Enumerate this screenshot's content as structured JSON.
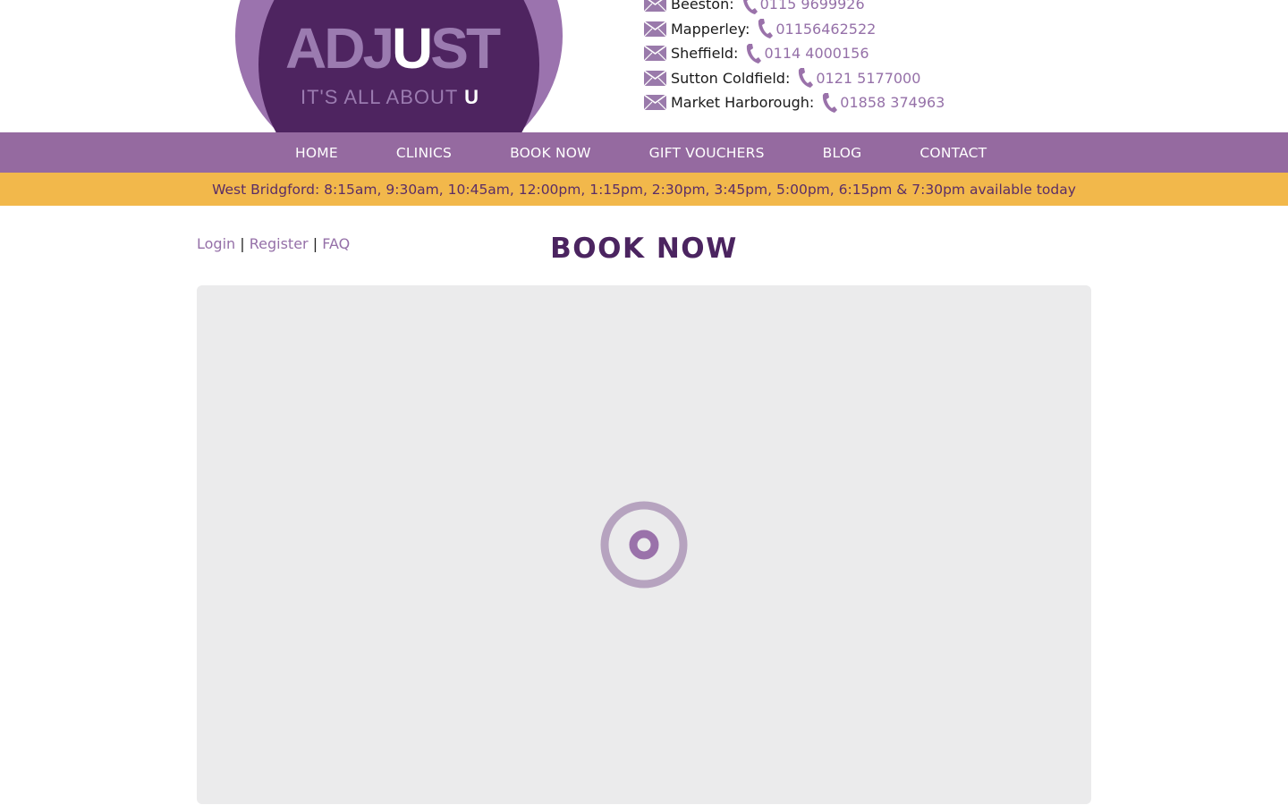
{
  "logo": {
    "adj": "ADJ",
    "u": "U",
    "st": "ST",
    "tagline": "IT'S ALL ABOUT",
    "tagline_u": "U"
  },
  "contacts": [
    {
      "name": "Beeston:",
      "phone": "0115 9699926"
    },
    {
      "name": "Mapperley:",
      "phone": "01156462522"
    },
    {
      "name": "Sheffield:",
      "phone": "0114 4000156"
    },
    {
      "name": "Sutton Coldfield:",
      "phone": "0121 5177000"
    },
    {
      "name": "Market Harborough:",
      "phone": "01858 374963"
    }
  ],
  "nav": {
    "items": [
      {
        "label": "HOME"
      },
      {
        "label": "CLINICS"
      },
      {
        "label": "BOOK NOW"
      },
      {
        "label": "GIFT VOUCHERS"
      },
      {
        "label": "BLOG"
      },
      {
        "label": "CONTACT"
      }
    ]
  },
  "banner": {
    "text": "West Bridgford: 8:15am, 9:30am, 10:45am, 12:00pm, 1:15pm, 2:30pm, 3:45pm, 5:00pm, 6:15pm & 7:30pm available today"
  },
  "account_links": {
    "login": "Login",
    "separator": "|",
    "register": "Register",
    "faq": "FAQ"
  },
  "page": {
    "title": "BOOK NOW"
  },
  "colors": {
    "brand_purple": "#4b2460",
    "nav_purple": "#956aa0",
    "link_purple": "#9570a8",
    "banner_yellow": "#f2b84b"
  },
  "icons": {
    "mail": "mail-icon",
    "phone": "phone-icon",
    "loading": "loading-spinner-icon"
  }
}
